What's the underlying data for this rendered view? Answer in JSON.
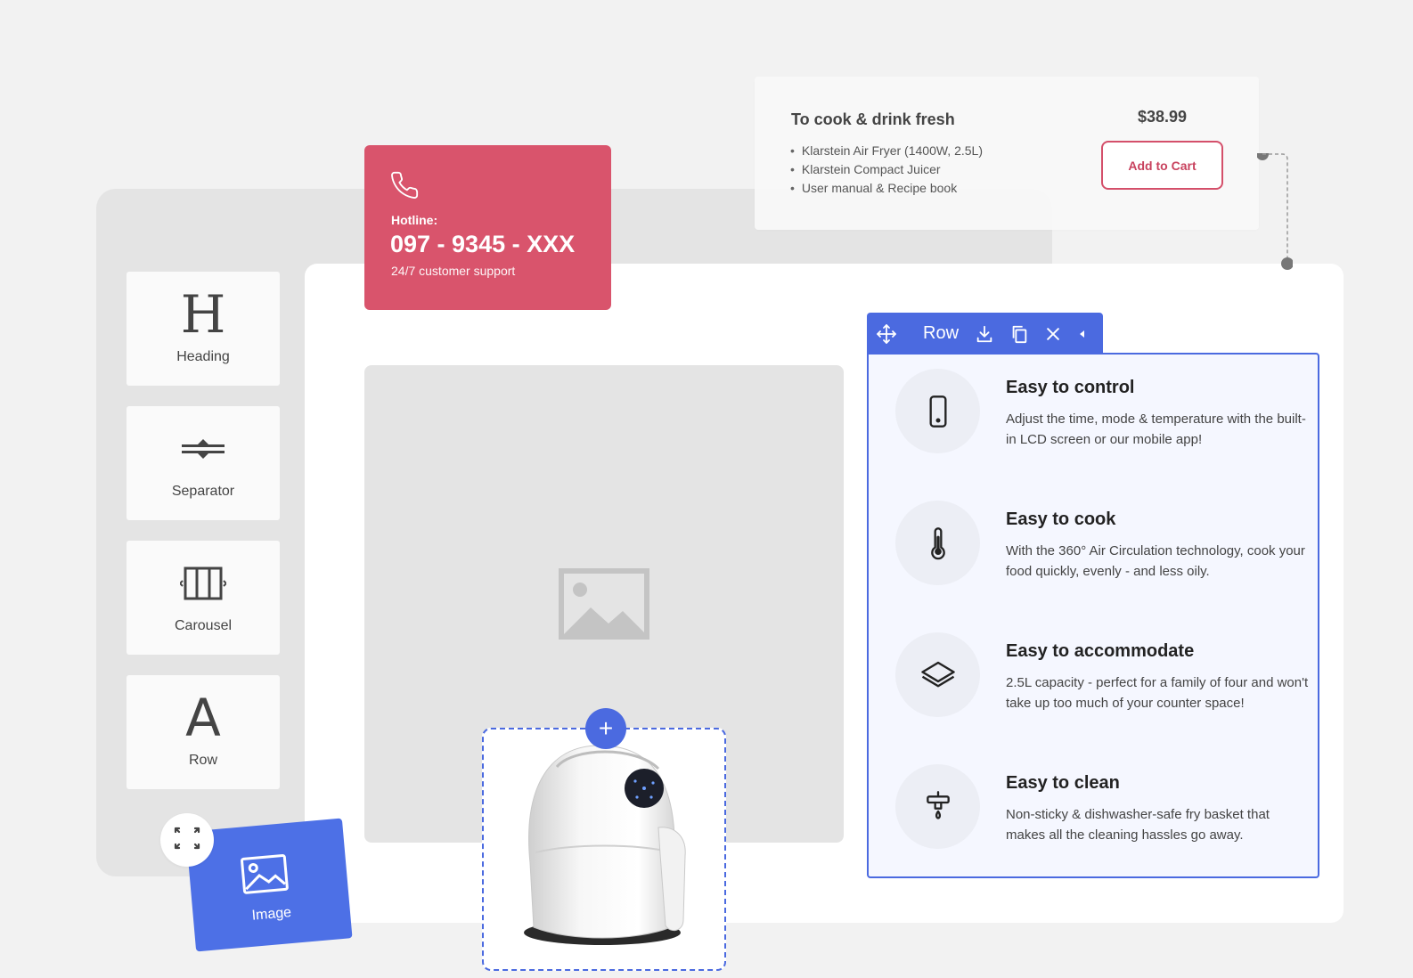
{
  "product_card": {
    "title": "To cook & drink fresh",
    "items": [
      "Klarstein Air Fryer (1400W, 2.5L)",
      "Klarstein Compact Juicer",
      "User manual & Recipe book"
    ],
    "price": "$38.99",
    "cta_label": "Add to Cart"
  },
  "hotline": {
    "label": "Hotline:",
    "number": "097 - 9345 - XXX",
    "subtext": "24/7 customer support"
  },
  "widgets": [
    {
      "icon": "heading-icon",
      "glyph": "H",
      "label": "Heading"
    },
    {
      "icon": "separator-icon",
      "label": "Separator"
    },
    {
      "icon": "carousel-icon",
      "label": "Carousel"
    },
    {
      "icon": "row-icon",
      "glyph": "A",
      "label": "Row"
    }
  ],
  "dragged_widget": {
    "icon": "image-icon",
    "label": "Image"
  },
  "dropzone": {
    "add_label": "+"
  },
  "toolbar": {
    "label": "Row",
    "icons": [
      "move-icon",
      "download-icon",
      "duplicate-icon",
      "close-icon",
      "collapse-arrow-icon"
    ]
  },
  "features": [
    {
      "icon": "smartphone-icon",
      "title": "Easy to control",
      "description": "Adjust the time, mode & temperature with the built-in LCD screen or our mobile app!"
    },
    {
      "icon": "thermometer-icon",
      "title": "Easy to cook",
      "description": "With the 360° Air Circulation technology, cook your food quickly, evenly - and less oily."
    },
    {
      "icon": "layers-icon",
      "title": "Easy to accommodate",
      "description": "2.5L capacity - perfect for a family of four and won't take up too much of your counter space!"
    },
    {
      "icon": "faucet-icon",
      "title": "Easy to clean",
      "description": "Non-sticky & dishwasher-safe fry basket that makes all the cleaning hassles go away."
    }
  ],
  "colors": {
    "accent_blue": "#4b6ae0",
    "hotline_red": "#d9546c",
    "cart_red": "#d44f6a"
  }
}
